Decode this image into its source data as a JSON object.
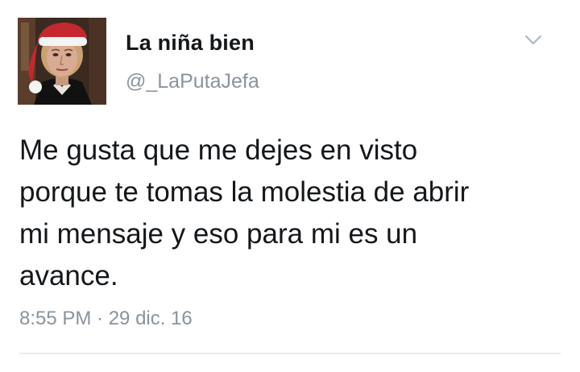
{
  "tweet": {
    "author": {
      "display_name": "La niña bien",
      "handle": "@_LaPutaJefa",
      "avatar_icon": "avatar-santa-hat"
    },
    "menu_icon": "chevron-down-icon",
    "text_lines": [
      "Me gusta que me dejes en visto",
      "porque te tomas la molestia de abrir",
      "mi mensaje y eso para mi es un",
      "avance."
    ],
    "timestamp": "8:55 PM · 29 dic. 16"
  },
  "colors": {
    "text": "#14171a",
    "secondary": "#8a939c",
    "divider": "#e6ecf0",
    "hat_red": "#c4282e"
  }
}
